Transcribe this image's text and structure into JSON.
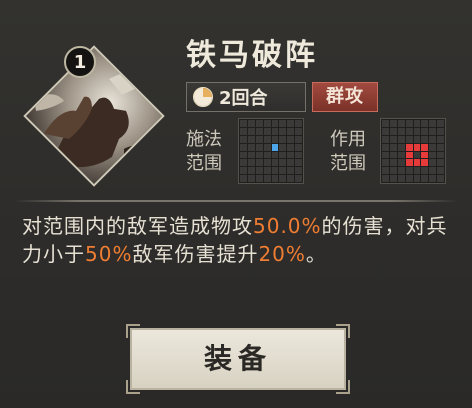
{
  "skill": {
    "name": "铁马破阵",
    "level": "1",
    "icon": "cavalry-skill-art-icon",
    "rounds_text": "2回合",
    "rounds_icon": "round-timer-icon",
    "type_label": "群攻"
  },
  "cast_range": {
    "label_line1": "施法",
    "label_line2": "范围",
    "highlighted_cells": [
      [
        3,
        4
      ]
    ],
    "color": "#4ea6ea"
  },
  "effect_range": {
    "label_line1": "作用",
    "label_line2": "范围",
    "highlighted_cells": [
      [
        3,
        3
      ],
      [
        3,
        4
      ],
      [
        3,
        5
      ],
      [
        4,
        3
      ],
      [
        4,
        5
      ],
      [
        5,
        3
      ],
      [
        5,
        4
      ],
      [
        5,
        5
      ]
    ],
    "color": "#e73a3a"
  },
  "description": {
    "part1": "对范围内的敌军造成物攻",
    "value1": "50.0%",
    "part2": "的伤害，对兵力小于",
    "value2": "50%",
    "part3": "敌军伤害提升",
    "value3": "20%",
    "part4": "。",
    "highlight_color": "#ef7d32"
  },
  "actions": {
    "equip_label": "装备"
  }
}
